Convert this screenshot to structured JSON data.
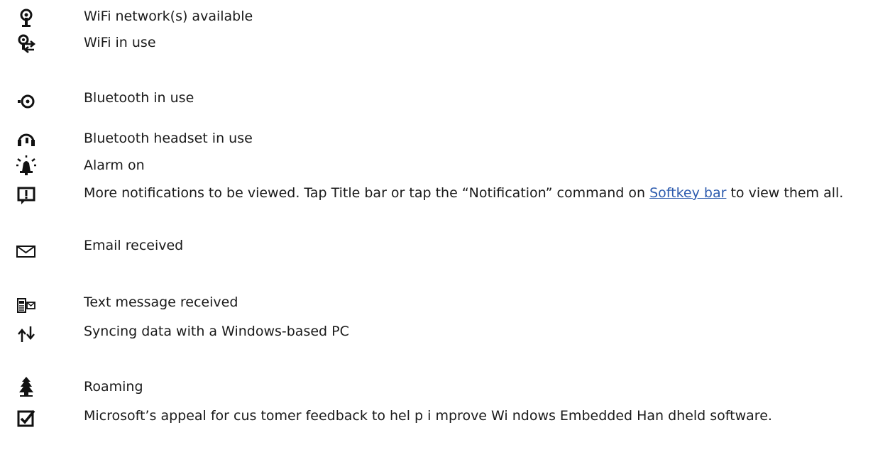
{
  "icons": {
    "wifi_available": "wifi-available-icon",
    "wifi_in_use": "wifi-in-use-icon",
    "bluetooth_in_use": "bluetooth-in-use-icon",
    "bluetooth_headset": "bluetooth-headset-icon",
    "alarm": "alarm-icon",
    "more_notifications": "more-notifications-icon",
    "email": "email-icon",
    "text_message": "text-message-icon",
    "sync": "sync-icon",
    "roaming": "roaming-icon",
    "feedback": "feedback-checkbox-icon"
  },
  "colors": {
    "text": "#1a1a1a",
    "link": "#2e5caf"
  },
  "rows": [
    {
      "text": "WiFi network(s) available"
    },
    {
      "text": "WiFi in use"
    },
    {
      "text": "Bluetooth in use"
    },
    {
      "text": "Bluetooth headset in use"
    },
    {
      "text": "Alarm on"
    },
    {
      "text_before": "More notifications to be viewed. Tap Title bar or tap the “Notification” command on ",
      "link": "Softkey bar",
      "text_after": " to view them all."
    },
    {
      "text": "Email received"
    },
    {
      "text": "Text message received"
    },
    {
      "text": "Syncing data with a Windows-based PC"
    },
    {
      "text": "Roaming"
    },
    {
      "text": "Microsoft’s appeal for cus tomer feedback to  hel p i mprove Wi ndows Embedded Han dheld software."
    }
  ]
}
